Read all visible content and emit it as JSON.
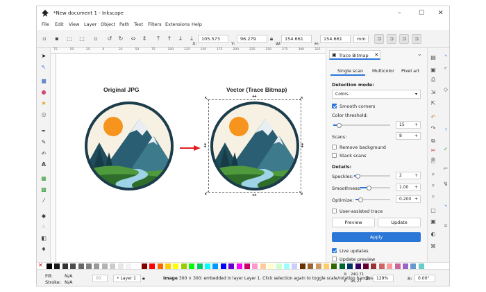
{
  "window": {
    "title": "*New document 1 - Inkscape",
    "minimize": "–",
    "maximize": "☐",
    "close": "✕"
  },
  "menu": [
    "File",
    "Edit",
    "View",
    "Layer",
    "Object",
    "Path",
    "Text",
    "Filters",
    "Extensions",
    "Help"
  ],
  "command_bar": {
    "x_label": "X:",
    "x_value": "105.573",
    "y_label": "Y:",
    "y_value": "96.279",
    "w_label": "W:",
    "w_value": "154.661",
    "h_label": "H:",
    "h_value": "154.661",
    "unit": "mm"
  },
  "ruler": {
    "ticks": [
      "75",
      "50",
      "25",
      "0",
      "25",
      "50",
      "75",
      "100",
      "125",
      "150",
      "175",
      "200",
      "225",
      "250",
      "275",
      "300",
      "325"
    ]
  },
  "canvas": {
    "left_caption": "Original JPG",
    "right_caption": "Vector (Trace Bitmap)"
  },
  "panel": {
    "tab_title": "Trace Bitmap",
    "tab_close": "×",
    "modes": [
      "Single scan",
      "Multicolor",
      "Pixel art"
    ],
    "active_mode": 0,
    "detection_label": "Detection mode:",
    "detection_value": "Colors",
    "smooth_corners": "Smooth corners",
    "smooth_corners_checked": true,
    "threshold_label": "Color threshold:",
    "threshold_value": "15",
    "threshold_level": 0.1,
    "scans_label": "Scans:",
    "scans_value": "8",
    "remove_background": "Remove background",
    "stack_scans": "Stack scans",
    "details_label": "Details:",
    "speckles_label": "Speckles:",
    "speckles_value": "2",
    "speckles_level": 0.1,
    "smoothness_label": "Smoothness:",
    "smoothness_value": "1.00",
    "smoothness_level": 0.3,
    "optimize_label": "Optimize:",
    "optimize_value": "0.200",
    "optimize_level": 0.15,
    "user_assisted": "User-assisted trace",
    "preview_button": "Preview",
    "update_button": "Update",
    "apply_button": "Apply",
    "live_updates": "Live updates",
    "live_updates_checked": true,
    "update_preview": "Update preview"
  },
  "status": {
    "fill_label": "Fill:",
    "fill_value": "N/A",
    "stroke_label": "Stroke:",
    "stroke_value": "N/A",
    "opacity_value": "00",
    "layer_value": "• Layer 1",
    "message_bold": "Image",
    "message_rest": " 300 × 300: embedded in layer Layer 1. Click selection again to toggle scale/rotation handles.",
    "x_label": "X:",
    "x_value": "240.71",
    "y_label": "Y:",
    "y_value": "95.27",
    "z_label": "Z:",
    "zoom_value": "129%",
    "r_label": "R:",
    "rotation_value": "0.00°"
  },
  "palette": [
    "#000000",
    "#1a1a1a",
    "#333333",
    "#4d4d4d",
    "#666666",
    "#808080",
    "#999999",
    "#b3b3b3",
    "#cccccc",
    "#e6e6e6",
    "#f2f2f2",
    "#ffffff",
    "#800000",
    "#ff0000",
    "#ff6600",
    "#ffcc00",
    "#ffff00",
    "#99cc00",
    "#00ff00",
    "#00cc66",
    "#00ffff",
    "#0099ff",
    "#0000ff",
    "#6600cc",
    "#ff00ff",
    "#cc0066",
    "#ff99cc",
    "#ffcc99",
    "#ffffcc",
    "#ccffcc",
    "#99ffff",
    "#ccccff",
    "#663300",
    "#996633",
    "#cc9966",
    "#ffcc66",
    "#336600",
    "#006633",
    "#003366",
    "#330066",
    "#660033",
    "#993333",
    "#cc6666",
    "#ff9999",
    "#cc6699",
    "#9966cc",
    "#6699cc",
    "#66cccc"
  ],
  "colors": {
    "accent": "#2b77d8",
    "sun": "#f7941d",
    "arrow": "#e02020",
    "frame": "#1b3c4a"
  }
}
